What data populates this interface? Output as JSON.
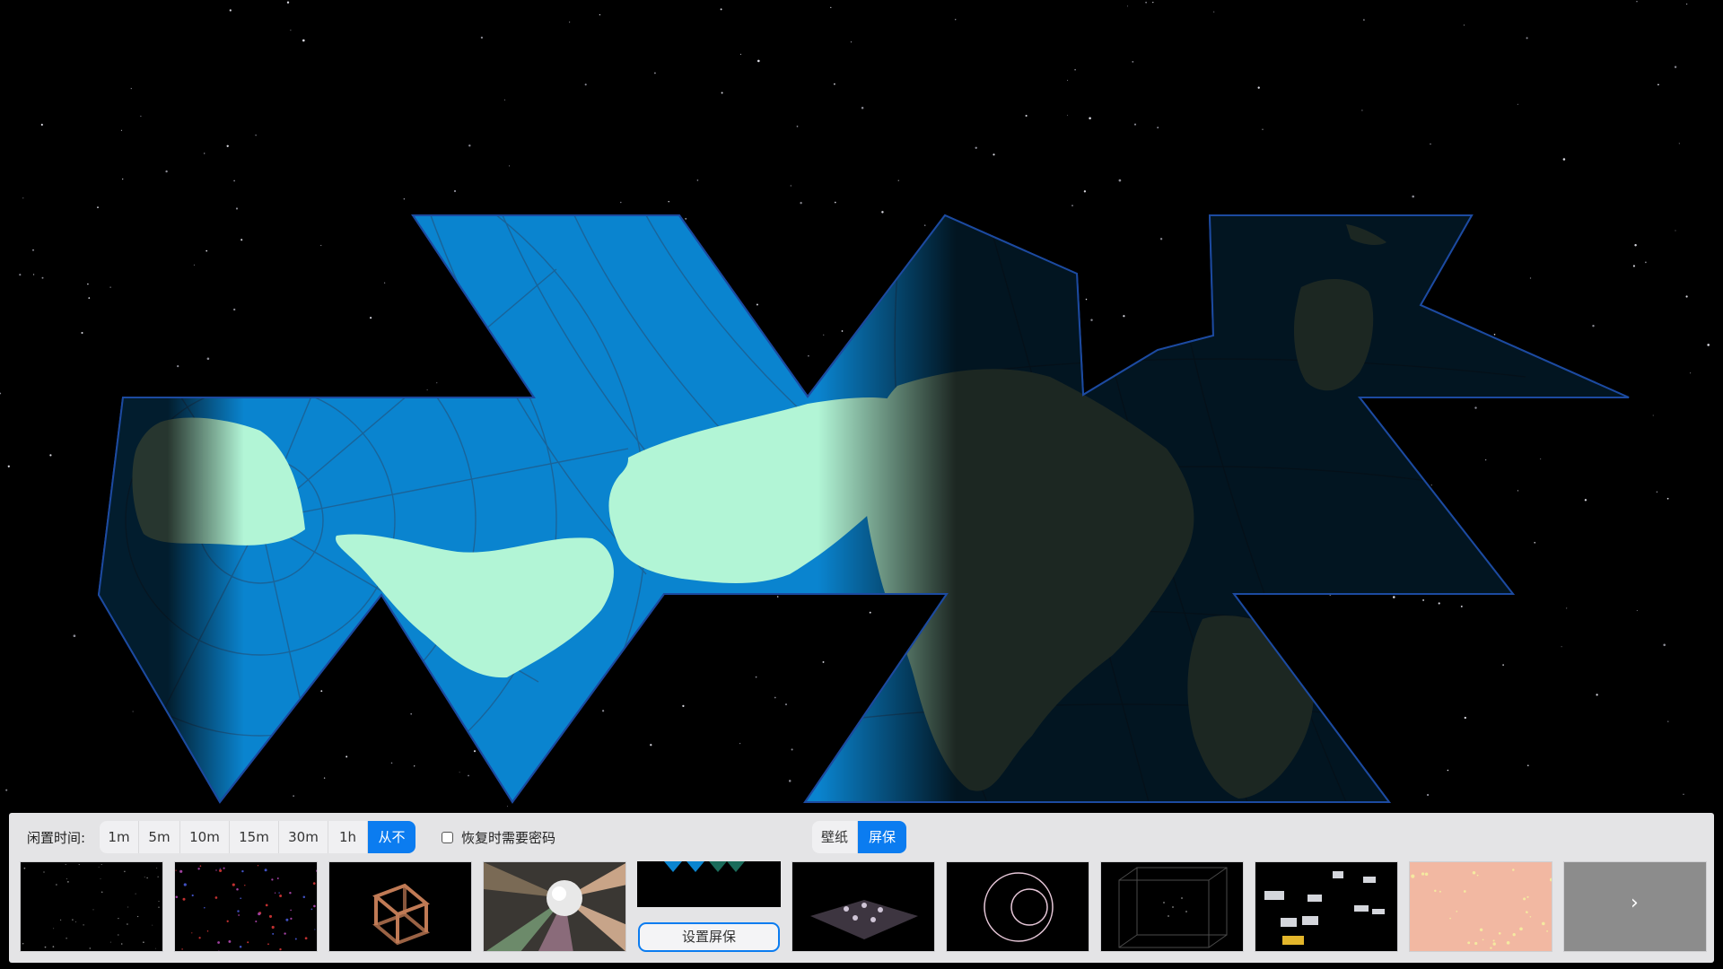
{
  "controls": {
    "idle_label": "闲置时间:",
    "idle_options": [
      "1m",
      "5m",
      "10m",
      "15m",
      "30m",
      "1h",
      "从不"
    ],
    "idle_selected": "从不",
    "password_label": "恢复时需要密码",
    "password_checked": false,
    "mode_tabs": [
      "壁纸",
      "屏保"
    ],
    "mode_selected": "屏保"
  },
  "thumbnails": [
    {
      "name": "starfield-thumbnail",
      "selected": false
    },
    {
      "name": "particle-sphere-thumbnail",
      "selected": false
    },
    {
      "name": "wire-cube-thumbnail",
      "selected": false
    },
    {
      "name": "light-beams-ball-thumbnail",
      "selected": false
    },
    {
      "name": "world-map-thumbnail",
      "selected": true
    },
    {
      "name": "grid-plane-thumbnail",
      "selected": false
    },
    {
      "name": "pink-rings-thumbnail",
      "selected": false
    },
    {
      "name": "dot-cube-thumbnail",
      "selected": false
    },
    {
      "name": "spaceships-thumbnail",
      "selected": false
    },
    {
      "name": "peach-dots-thumbnail",
      "selected": false
    },
    {
      "name": "more-thumbnail",
      "selected": false
    }
  ],
  "set_screensaver_label": "设置屏保",
  "next_icon": "chevron-right-icon",
  "colors": {
    "accent": "#0b7cf0",
    "ocean": "#0a84cf",
    "land_day": "#b2f5d6",
    "land_night": "#1d2e1e",
    "panel": "#e4e4e6"
  }
}
